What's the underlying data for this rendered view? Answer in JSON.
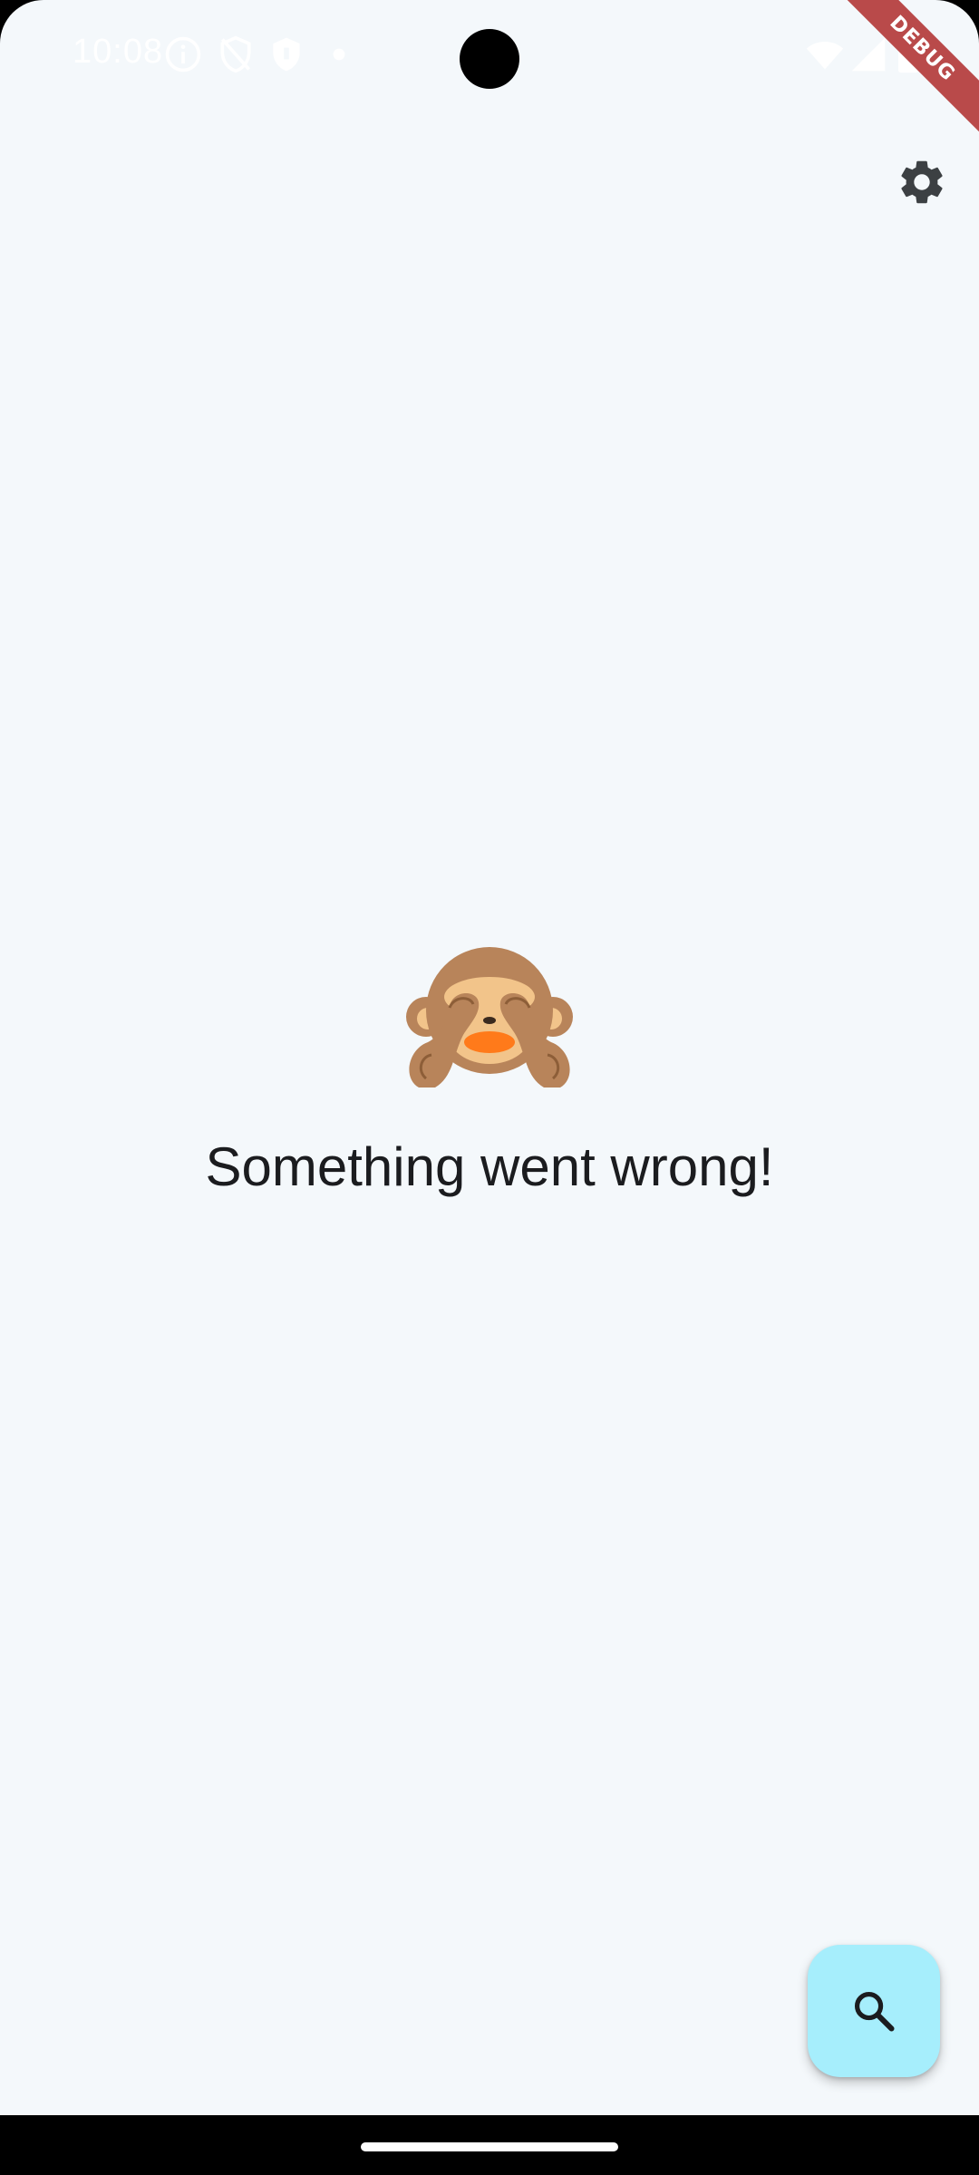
{
  "status_bar": {
    "time": "10:08",
    "icons": [
      "info-icon",
      "shield-off-icon",
      "shield-icon",
      "dot-icon",
      "wifi-icon",
      "signal-icon",
      "battery-icon"
    ]
  },
  "debug_banner": {
    "label": "DEBUG",
    "color": "#b94a4a"
  },
  "toolbar": {
    "settings_icon": "gear-icon"
  },
  "error_state": {
    "emoji": "see-no-evil-monkey-icon",
    "message": "Something went wrong!"
  },
  "fab": {
    "icon": "search-icon",
    "color": "#a6eefc"
  },
  "colors": {
    "background": "#f4f8fb",
    "text": "#1b1c1f",
    "icon": "#3c4043"
  }
}
